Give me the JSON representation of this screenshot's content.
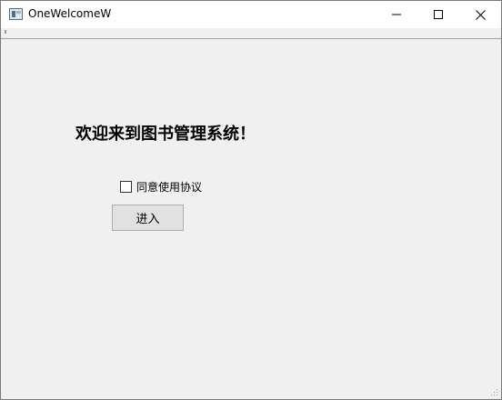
{
  "window": {
    "title": "OneWelcomeW",
    "icon": "app-window-icon",
    "controls": [
      "minimize-icon",
      "maximize-icon",
      "close-icon"
    ]
  },
  "main": {
    "heading": "欢迎来到图书管理系统！",
    "agreement_checkbox": {
      "label": "同意使用协议",
      "checked": false
    },
    "enter_button_label": "进入"
  },
  "colors": {
    "background": "#f0f0f0",
    "titlebar": "#ffffff",
    "button_face": "#e1e1e1",
    "button_border": "#adadad"
  }
}
